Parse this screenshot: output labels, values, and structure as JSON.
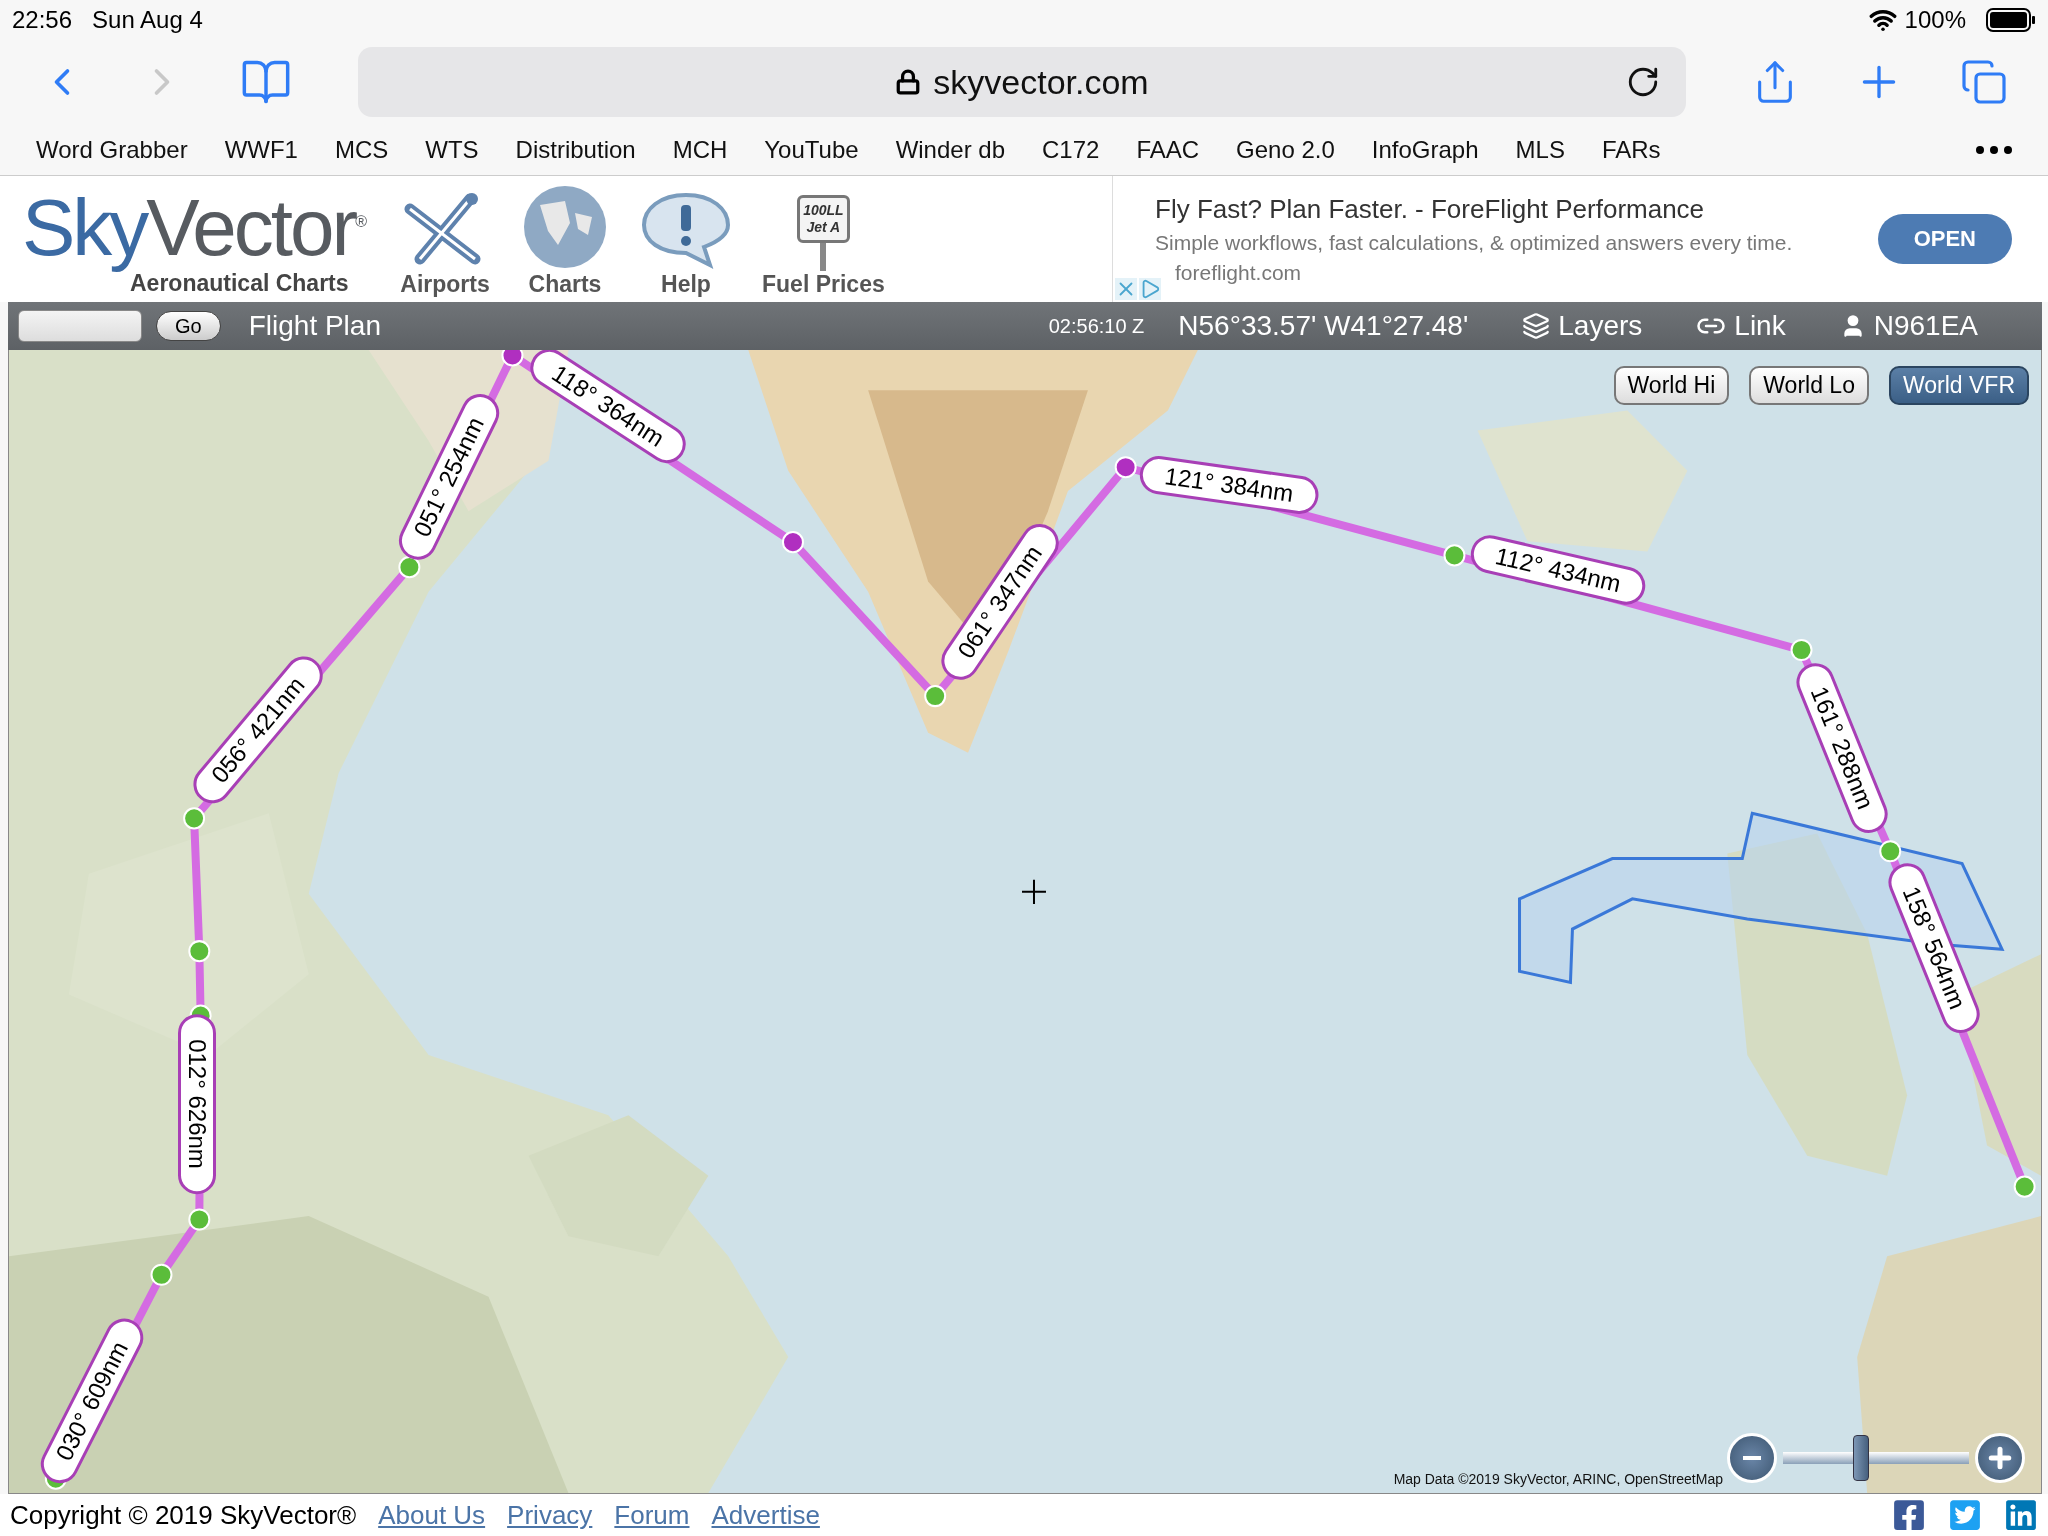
{
  "status_bar": {
    "time": "22:56",
    "date": "Sun Aug 4",
    "battery": "100%"
  },
  "browser": {
    "url": "skyvector.com",
    "forward_disabled": true,
    "bookmarks": [
      "Word Grabber",
      "WWF1",
      "MCS",
      "WTS",
      "Distribution",
      "MCH",
      "YouTube",
      "Winder db",
      "C172",
      "FAAC",
      "Geno 2.0",
      "InfoGraph",
      "MLS",
      "FARs"
    ]
  },
  "site_header": {
    "logo_first": "Sky",
    "logo_second": "Vector",
    "logo_mark": "®",
    "tagline": "Aeronautical Charts",
    "nav": [
      {
        "kind": "airports",
        "label": "Airports"
      },
      {
        "kind": "charts",
        "label": "Charts"
      },
      {
        "kind": "help",
        "label": "Help"
      },
      {
        "kind": "fuel",
        "label": "Fuel Prices",
        "sign": [
          "100LL",
          "Jet A"
        ]
      }
    ],
    "ad": {
      "title": "Fly Fast? Plan Faster. - ForeFlight Performance",
      "body": "Simple workflows, fast calculations, & optimized answers every time.",
      "domain": "foreflight.com",
      "button": "OPEN"
    }
  },
  "map_toolbar": {
    "go": "Go",
    "flight_plan": "Flight Plan",
    "time": "02:56:10 Z",
    "position": "N56°33.57' W41°27.48'",
    "layers": "Layers",
    "link": "Link",
    "user": "N961EA"
  },
  "chart_buttons": [
    {
      "label": "World Hi",
      "selected": false
    },
    {
      "label": "World Lo",
      "selected": false
    },
    {
      "label": "World VFR",
      "selected": true
    }
  ],
  "route_legs": [
    "118° 364nm",
    "051° 254nm",
    "056° 421nm",
    "012° 626nm",
    "030° 609nm",
    "061° 347nm",
    "121° 384nm",
    "112° 434nm",
    "161° 288nm",
    "158° 564nm"
  ],
  "attribution": "Map Data ©2019 SkyVector, ARINC, OpenStreetMap",
  "zoom": {
    "level": 0.42
  },
  "footer": {
    "copyright": "Copyright © 2019 SkyVector®",
    "links": [
      "About Us",
      "Privacy",
      "Forum",
      "Advertise"
    ],
    "social": [
      {
        "kind": "facebook"
      },
      {
        "kind": "twitter"
      },
      {
        "kind": "linkedin"
      }
    ]
  }
}
